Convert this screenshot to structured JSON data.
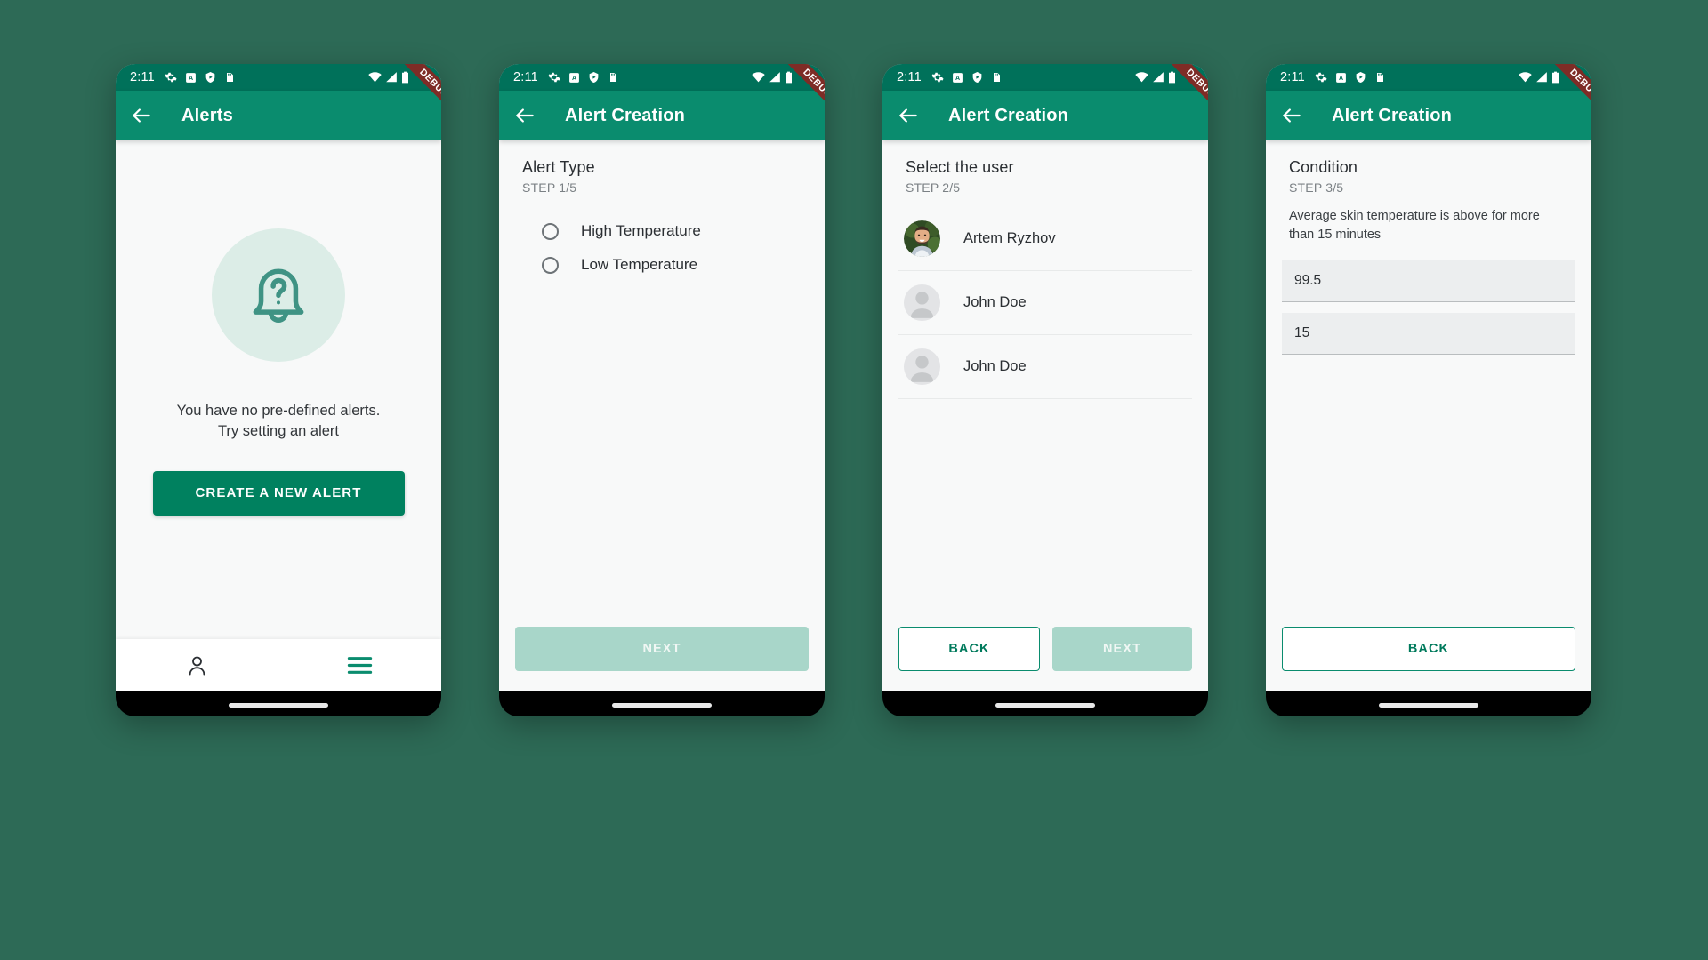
{
  "theme": {
    "background": "#2d6a56",
    "appbar": "#0a8c6e",
    "statusbar": "#00715a",
    "primary": "#00815f",
    "disabled_next": "#a8d6c9",
    "screen_bg": "#f8f9f9",
    "ribbon": "#7e2c26"
  },
  "statusbar": {
    "time": "2:11",
    "left_icons": [
      "gear-icon",
      "a-badge-icon",
      "shield-play-icon",
      "sd-card-icon"
    ],
    "right_icons": [
      "wifi-icon",
      "signal-icon",
      "battery-icon"
    ],
    "ribbon_label": "DEBUG"
  },
  "phones": [
    {
      "id": "alerts-empty",
      "appbar": {
        "title": "Alerts",
        "back_icon": "arrow-left-icon"
      },
      "empty_state": {
        "icon": "bell-question-icon",
        "line1": "You have no pre-defined alerts.",
        "line2": "Try setting an alert",
        "cta_label": "CREATE A NEW ALERT"
      },
      "bottom_nav": [
        {
          "icon": "person-icon",
          "active": false
        },
        {
          "icon": "hamburger-menu-icon",
          "active": true
        }
      ]
    },
    {
      "id": "alert-type",
      "appbar": {
        "title": "Alert Creation",
        "back_icon": "arrow-left-icon"
      },
      "step": {
        "title": "Alert Type",
        "subtitle": "STEP 1/5"
      },
      "options": [
        {
          "label": "High Temperature",
          "selected": false
        },
        {
          "label": "Low Temperature",
          "selected": false
        }
      ],
      "footer": [
        {
          "label": "NEXT",
          "style": "disabled"
        }
      ]
    },
    {
      "id": "select-user",
      "appbar": {
        "title": "Alert Creation",
        "back_icon": "arrow-left-icon"
      },
      "step": {
        "title": "Select the user",
        "subtitle": "STEP 2/5"
      },
      "users": [
        {
          "name": "Artem Ryzhov",
          "avatar": "photo"
        },
        {
          "name": "John Doe",
          "avatar": "placeholder"
        },
        {
          "name": "John Doe",
          "avatar": "placeholder"
        }
      ],
      "footer": [
        {
          "label": "BACK",
          "style": "outline"
        },
        {
          "label": "NEXT",
          "style": "disabled"
        }
      ]
    },
    {
      "id": "condition",
      "appbar": {
        "title": "Alert Creation",
        "back_icon": "arrow-left-icon"
      },
      "step": {
        "title": "Condition",
        "subtitle": "STEP 3/5"
      },
      "description": "Average skin temperature is above for more than 15 minutes",
      "fields": [
        {
          "value": "99.5"
        },
        {
          "value": "15"
        }
      ],
      "footer": [
        {
          "label": "BACK",
          "style": "outline"
        }
      ]
    }
  ]
}
